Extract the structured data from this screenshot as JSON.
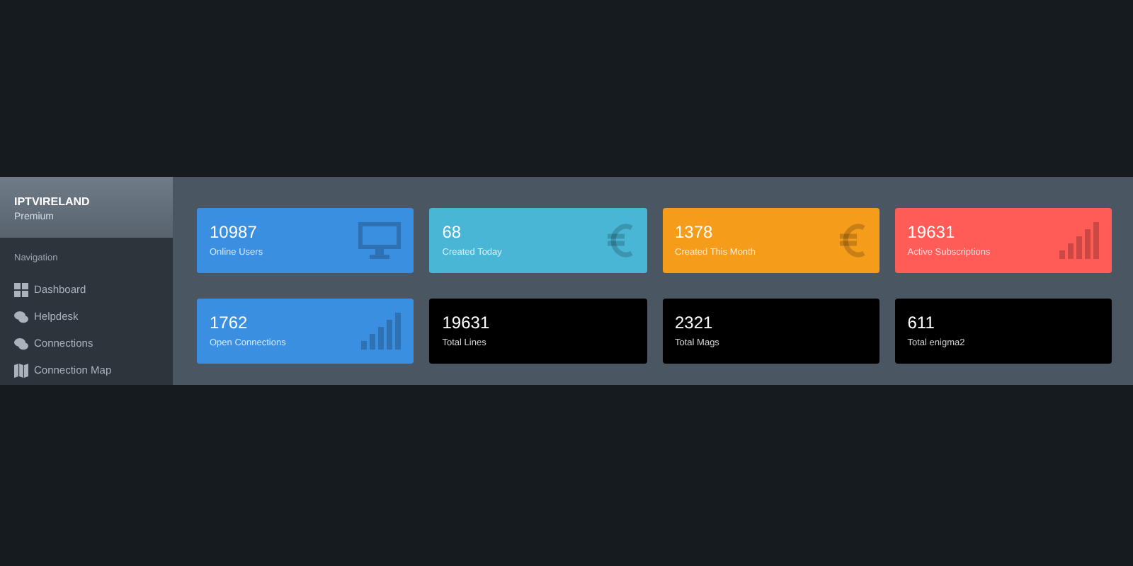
{
  "sidebar": {
    "brand": "IPTVIRELAND",
    "plan": "Premium",
    "section": "Navigation",
    "items": [
      {
        "label": "Dashboard",
        "kind": "grid"
      },
      {
        "label": "Helpdesk",
        "kind": "chat"
      },
      {
        "label": "Connections",
        "kind": "chat"
      },
      {
        "label": "Connection Map",
        "kind": "map"
      }
    ]
  },
  "cards": [
    {
      "value": "10987",
      "label": "Online Users",
      "color": "#3a8fe0",
      "kind": "monitor"
    },
    {
      "value": "68",
      "label": "Created Today",
      "color": "#49b6d6",
      "kind": "euro"
    },
    {
      "value": "1378",
      "label": "Created This Month",
      "color": "#f59c1a",
      "kind": "euro"
    },
    {
      "value": "19631",
      "label": "Active Subscriptions",
      "color": "#ff5b57",
      "kind": "signal"
    },
    {
      "value": "1762",
      "label": "Open Connections",
      "color": "#3a8fe0",
      "kind": "signal"
    },
    {
      "value": "19631",
      "label": "Total Lines",
      "color": "#000000",
      "kind": "plain"
    },
    {
      "value": "2321",
      "label": "Total Mags",
      "color": "#000000",
      "kind": "plain"
    },
    {
      "value": "611",
      "label": "Total enigma2",
      "color": "#000000",
      "kind": "plain"
    }
  ]
}
